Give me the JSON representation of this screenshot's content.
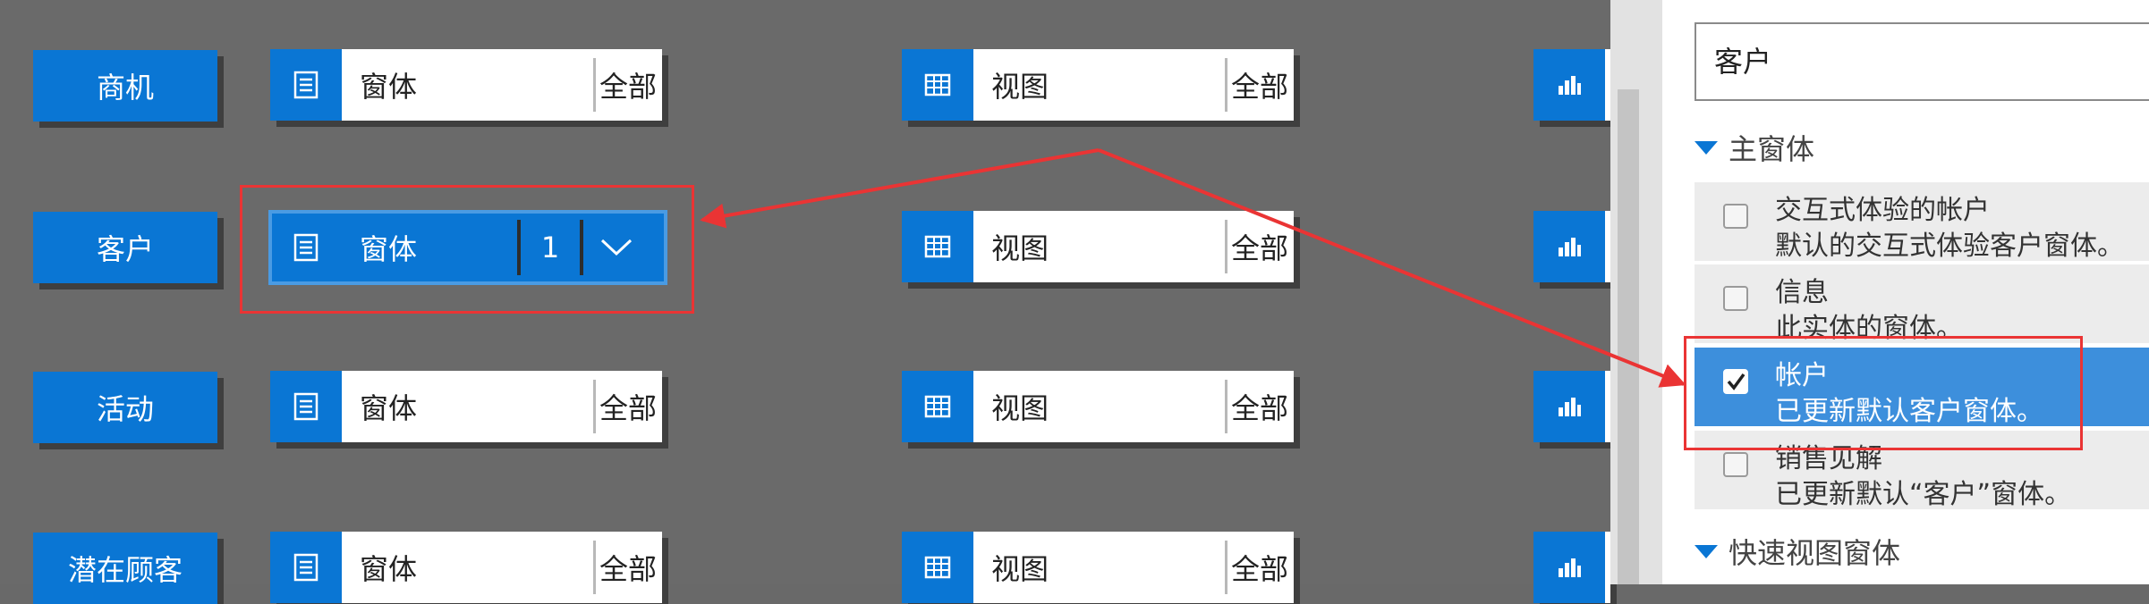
{
  "entities": [
    "商机",
    "客户",
    "活动",
    "潜在顾客"
  ],
  "tiles": {
    "form_label": "窗体",
    "view_label": "视图",
    "all_label": "全部"
  },
  "selected_tile": {
    "label": "窗体",
    "count": "1"
  },
  "panel": {
    "entity_value": "客户",
    "main_form_header": "主窗体",
    "quick_view_header": "快速视图窗体",
    "forms": [
      {
        "name": "交互式体验的帐户",
        "description": "默认的交互式体验客户窗体。",
        "checked": false
      },
      {
        "name": "信息",
        "description": "此实体的窗体。",
        "checked": false
      },
      {
        "name": "帐户",
        "description": "已更新默认客户窗体。",
        "checked": true
      },
      {
        "name": "销售见解",
        "description": "已更新默认“客户”窗体。",
        "checked": false
      }
    ]
  },
  "colors": {
    "accent": "#0a76d4",
    "annotation": "#ea3434",
    "background": "#6a6a6a"
  },
  "icons": {
    "form": "form-list-icon",
    "view": "grid-view-icon",
    "chart": "bar-chart-icon",
    "expand": "chevron-down-icon",
    "section": "triangle-down-icon",
    "check": "checkmark-icon"
  }
}
